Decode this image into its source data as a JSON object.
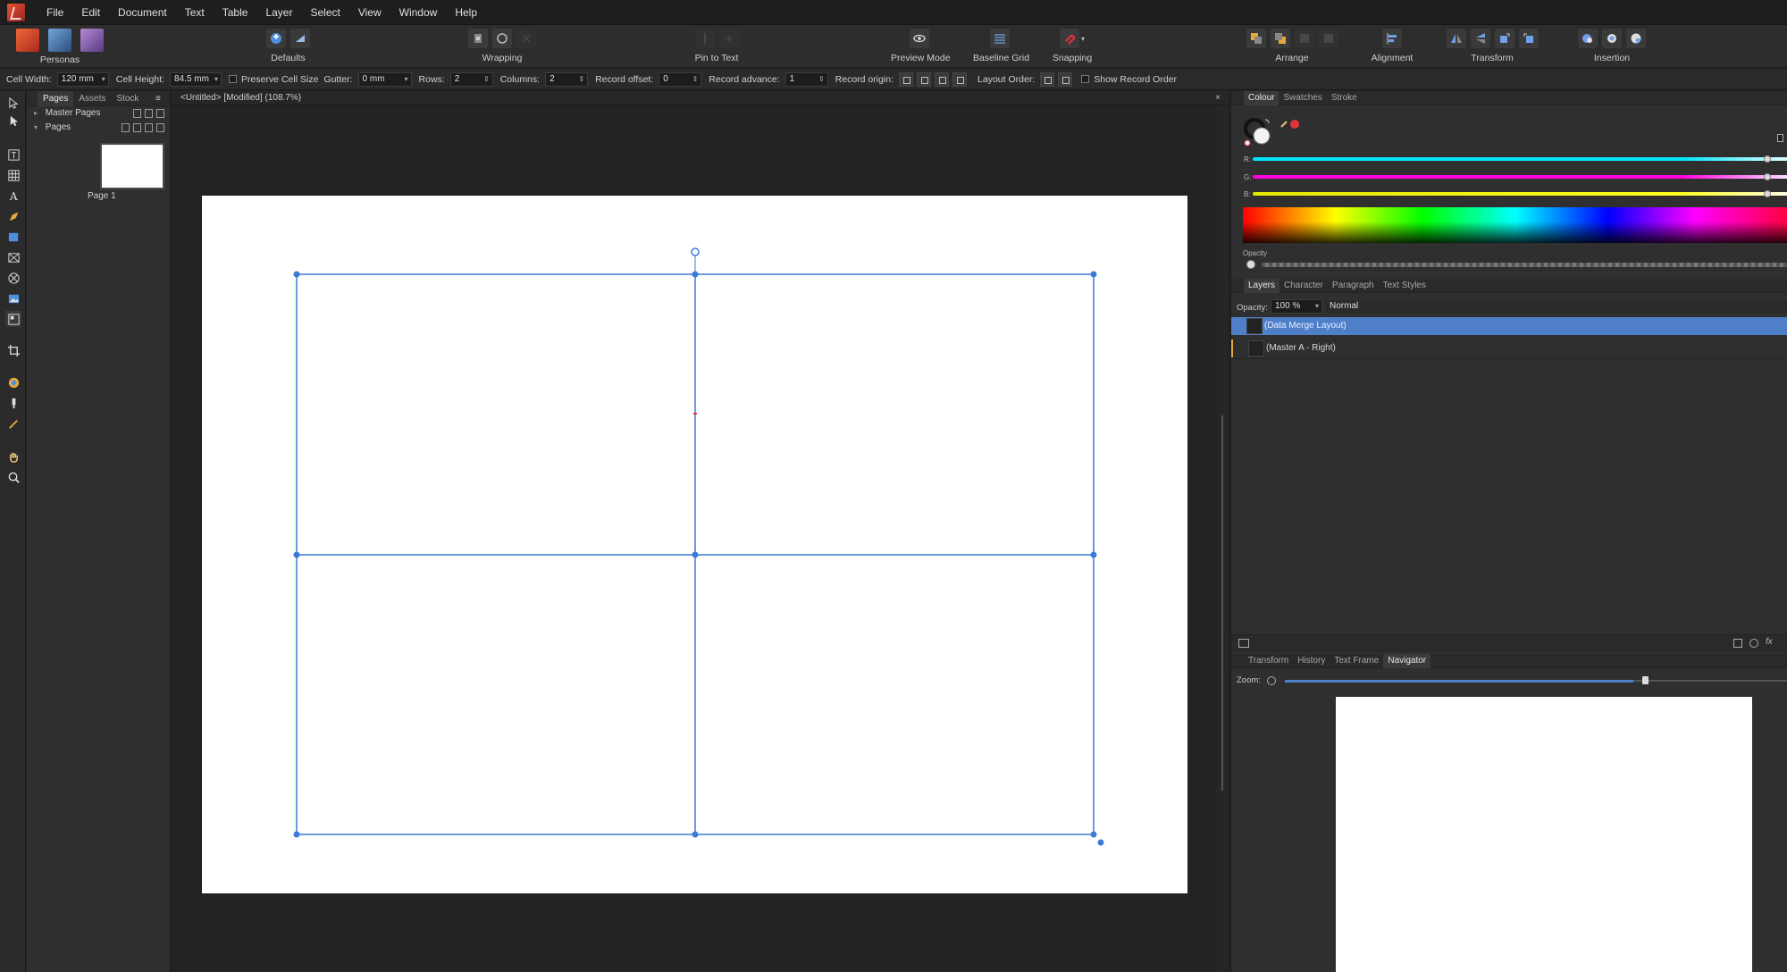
{
  "menu": [
    "File",
    "Edit",
    "Document",
    "Text",
    "Table",
    "Layer",
    "Select",
    "View",
    "Window",
    "Help"
  ],
  "toolbar": {
    "personas": "Personas",
    "defaults": "Defaults",
    "wrapping": "Wrapping",
    "pin_to_text": "Pin to Text",
    "preview_mode": "Preview Mode",
    "baseline_grid": "Baseline Grid",
    "snapping": "Snapping",
    "arrange": "Arrange",
    "alignment": "Alignment",
    "transform": "Transform",
    "insertion": "Insertion"
  },
  "context": {
    "cell_width_label": "Cell Width:",
    "cell_width": "120 mm",
    "cell_height_label": "Cell Height:",
    "cell_height": "84.5 mm",
    "preserve_cell_size": "Preserve Cell Size",
    "gutter_label": "Gutter:",
    "gutter": "0 mm",
    "rows_label": "Rows:",
    "rows": "2",
    "columns_label": "Columns:",
    "columns": "2",
    "record_offset_label": "Record offset:",
    "record_offset": "0",
    "record_advance_label": "Record advance:",
    "record_advance": "1",
    "record_origin_label": "Record origin:",
    "layout_order_label": "Layout Order:",
    "show_record_order": "Show Record Order"
  },
  "pages_panel": {
    "tabs": [
      "Pages",
      "Assets",
      "Stock"
    ],
    "master_pages": "Master Pages",
    "pages": "Pages",
    "page_label": "Page 1"
  },
  "document": {
    "tab_title": "<Untitled> [Modified] (108.7%)",
    "close": "×"
  },
  "colour_panel": {
    "tabs": [
      "Colour",
      "Swatches",
      "Stroke"
    ],
    "r_label": "R:",
    "g_label": "G:",
    "b_label": "B:",
    "opacity_label": "Opacity"
  },
  "layers_panel": {
    "tabs": [
      "Layers",
      "Character",
      "Paragraph",
      "Text Styles"
    ],
    "opacity_label": "Opacity:",
    "opacity_value": "100 %",
    "blend_mode": "Normal",
    "layers": [
      "(Data Merge Layout)",
      "(Master A - Right)"
    ]
  },
  "navigator_panel": {
    "tabs": [
      "Transform",
      "History",
      "Text Frame",
      "Navigator"
    ],
    "zoom_label": "Zoom:"
  },
  "colors": {
    "accent": "#4f7fc8",
    "layout_line": "#3b7bd6",
    "snapping_red": "#e0343a"
  }
}
